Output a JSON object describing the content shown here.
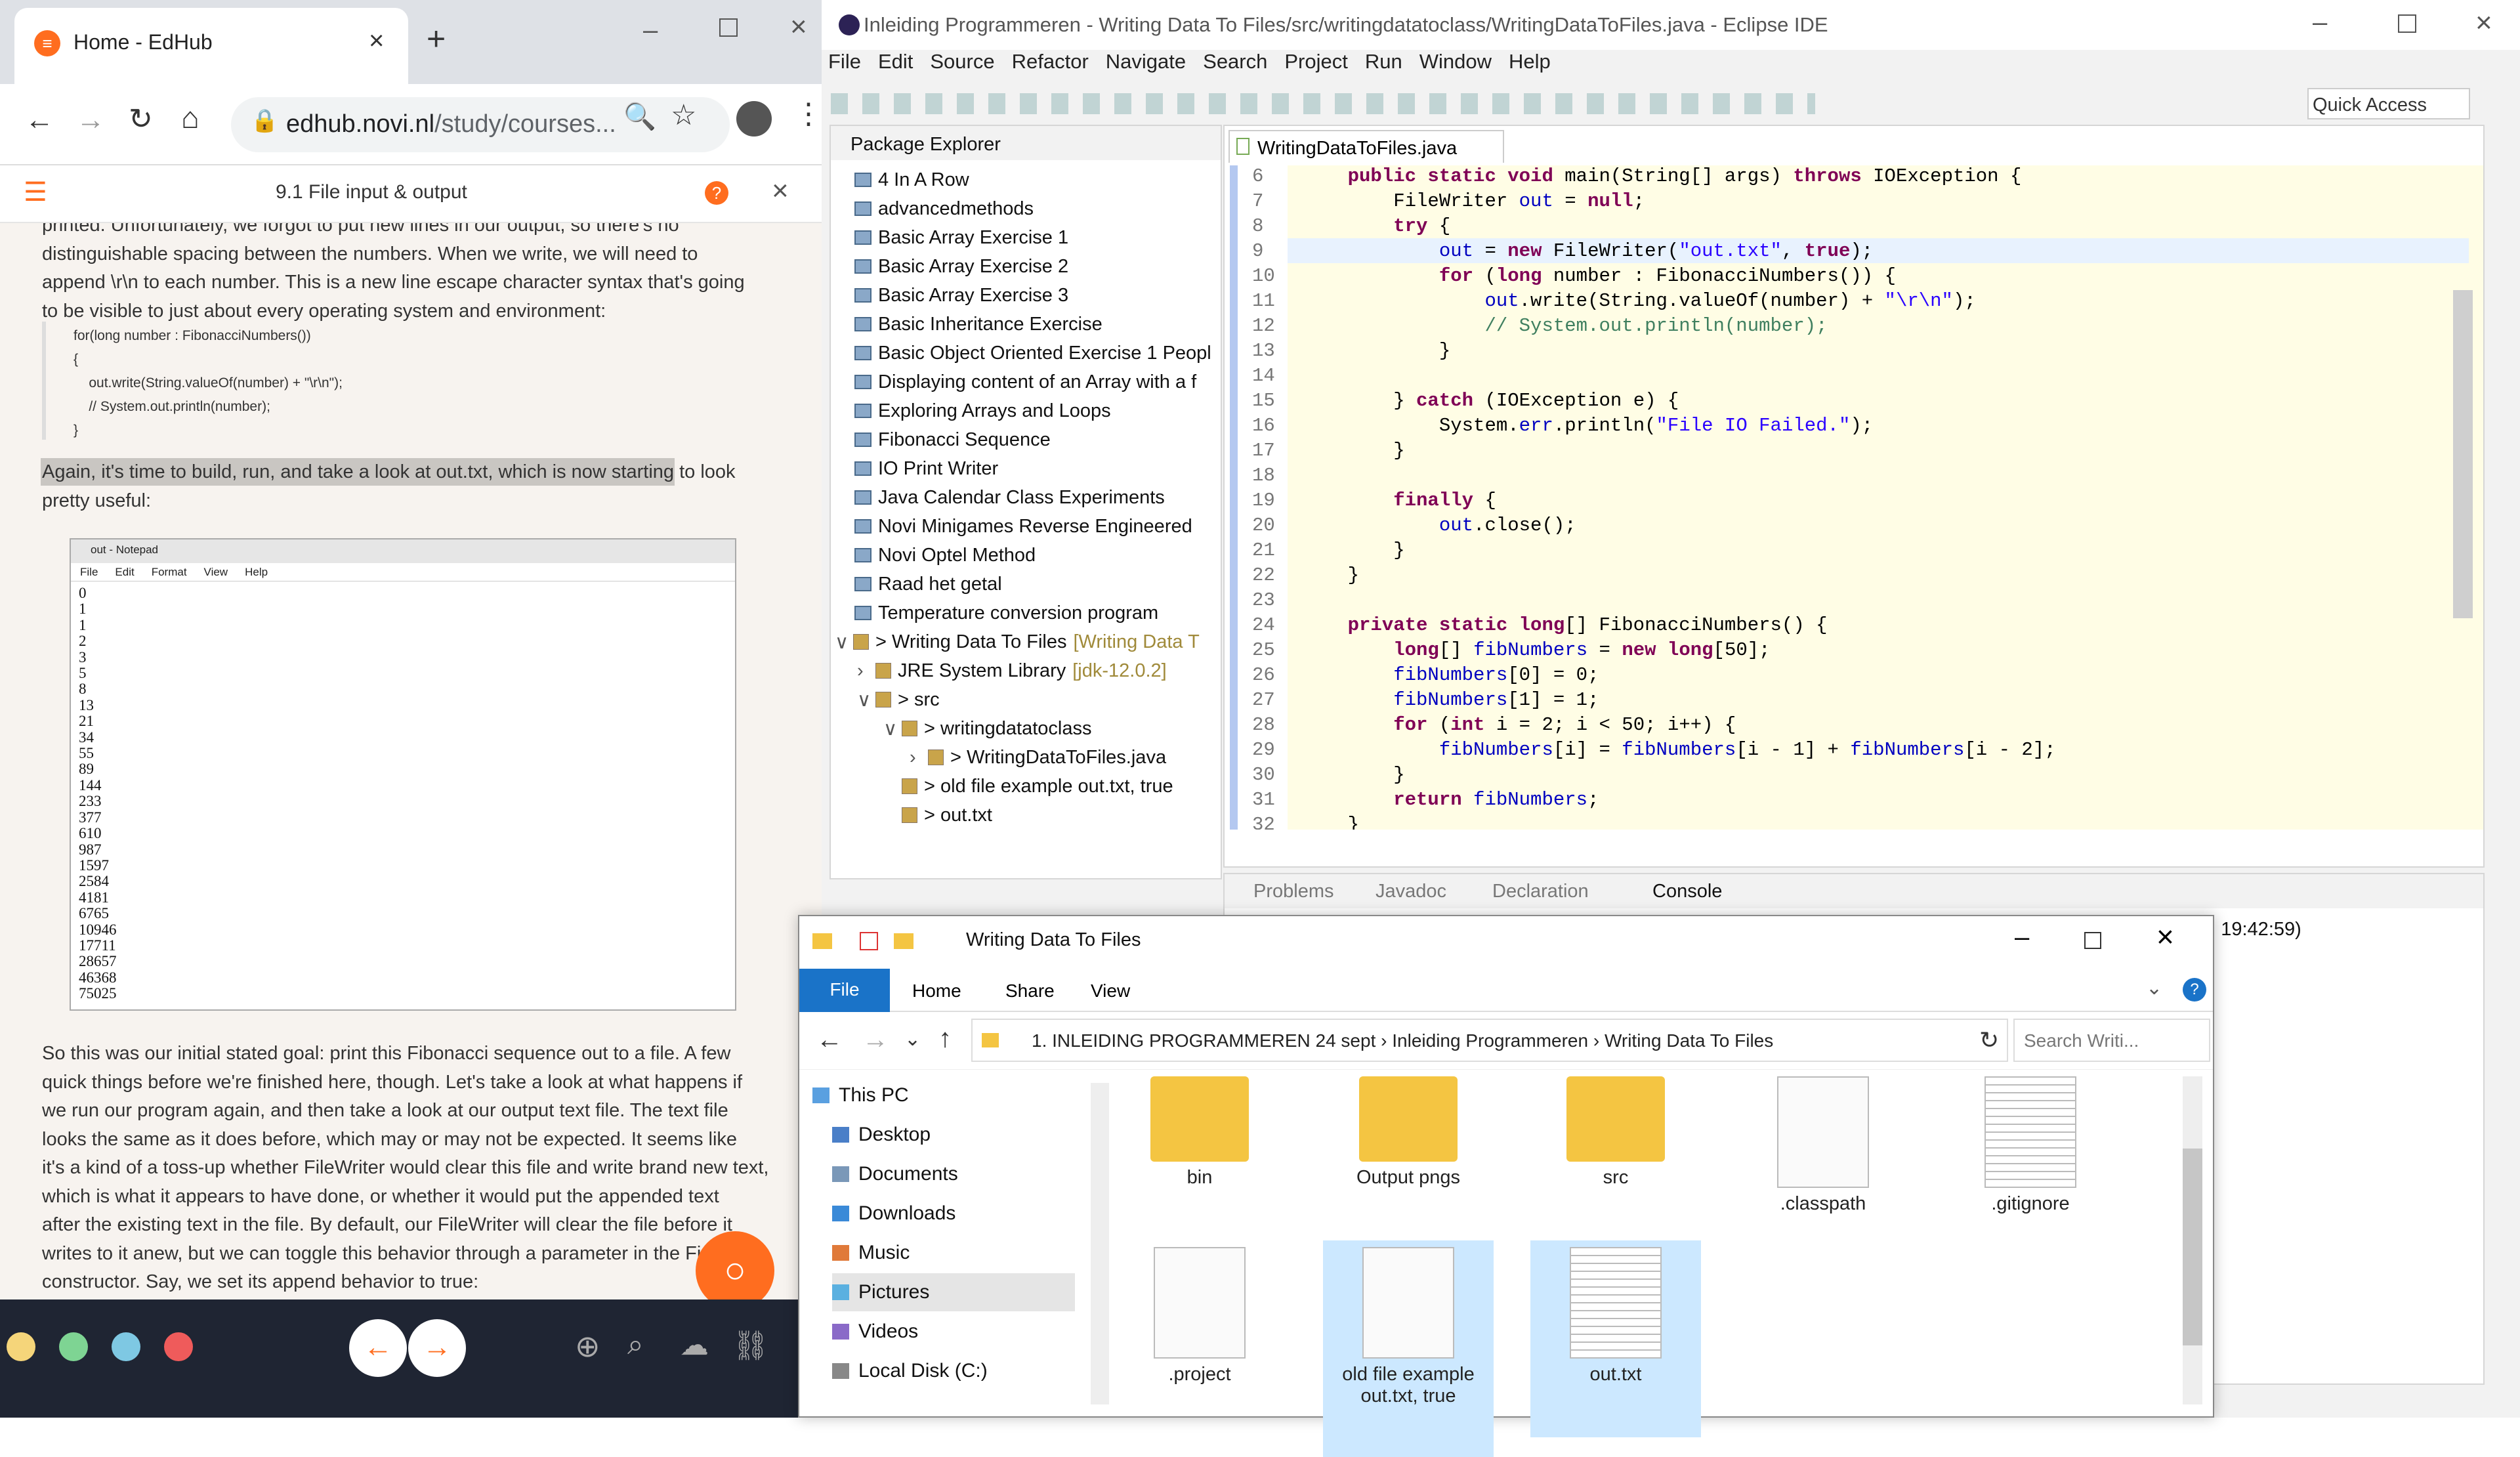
{
  "browser": {
    "tab_title": "Home - EdHub",
    "url_host": "edhub.novi.nl",
    "url_path": "/study/courses...",
    "section_title": "9.1 File input & output",
    "para1_lines": [
      "printed. Unfortunately, we forgot to put new lines in our output, so there's no",
      "distinguishable spacing between the numbers. When we write, we will need to",
      "append \\r\\n to each number. This is a new line escape character syntax that's going",
      "to be visible to just about every operating system and environment:"
    ],
    "code_lines": [
      "for(long number : FibonacciNumbers())",
      "{",
      "    out.write(String.valueOf(number) + \"\\r\\n\");",
      "    // System.out.println(number);",
      "}"
    ],
    "para2_lines": [
      "Again, it's time to build, run, and take a look at out.txt, which is now starting to look",
      "pretty useful:"
    ],
    "notepad": {
      "title": "out - Notepad",
      "menu": [
        "File",
        "Edit",
        "Format",
        "View",
        "Help"
      ],
      "content": "0\n1\n1\n2\n3\n5\n8\n13\n21\n34\n55\n89\n144\n233\n377\n610\n987\n1597\n2584\n4181\n6765\n10946\n17711\n28657\n46368\n75025"
    },
    "para3_lines": [
      "So this was our initial stated goal: print this Fibonacci sequence out to a file. A few",
      "quick things before we're finished here, though. Let's take a look at what happens if",
      "we run our program again, and then take a look at our output text file. The text file",
      "looks the same as it does before, which may or may not be expected. It seems like",
      "it's a kind of a toss-up whether FileWriter would clear this file and write brand new text,",
      "which is what it appears to have done, or whether it would put the appended text",
      "after the existing text in the file. By default, our FileWriter will clear the file before it",
      "writes to it anew, but we can toggle this behavior through a parameter in the Fi",
      "constructor. Say, we set its append behavior to true:"
    ],
    "colors": {
      "accent": "#ff6d1f",
      "dots": [
        "#f5d57a",
        "#7ed493",
        "#7ec8e3",
        "#ef5b5b"
      ]
    }
  },
  "eclipse": {
    "title": "Inleiding Programmeren - Writing Data To Files/src/writingdatatoclass/WritingDataToFiles.java - Eclipse IDE",
    "menu": [
      "File",
      "Edit",
      "Source",
      "Refactor",
      "Navigate",
      "Search",
      "Project",
      "Run",
      "Window",
      "Help"
    ],
    "quick_access": "Quick Access",
    "package_explorer": "Package Explorer",
    "projects": [
      "4 In A Row",
      "advancedmethods",
      "Basic Array Exercise 1",
      "Basic Array Exercise 2",
      "Basic Array Exercise 3",
      "Basic Inheritance Exercise",
      "Basic Object Oriented Exercise 1 Peopl",
      "Displaying content of an Array with a f",
      "Exploring Arrays and Loops",
      "Fibonacci Sequence",
      "IO Print Writer",
      "Java Calendar Class Experiments",
      "Novi Minigames Reverse Engineered",
      "Novi Optel Method",
      "Raad het getal",
      "Temperature conversion program"
    ],
    "open_project": "> Writing Data To Files",
    "open_project_tag": "[Writing Data T",
    "jre": "JRE System Library",
    "jre_tag": "[jdk-12.0.2]",
    "src": "> src",
    "pkg": "> writingdatatoclass",
    "file": "> WritingDataToFiles.java",
    "f1": "> old file example out.txt, true",
    "f2": "> out.txt",
    "editor_tab": "WritingDataToFiles.java",
    "line_numbers": [
      "6",
      "7",
      "8",
      "9",
      "10",
      "11",
      "12",
      "13",
      "14",
      "15",
      "16",
      "17",
      "18",
      "19",
      "20",
      "21",
      "22",
      "23",
      "24",
      "25",
      "26",
      "27",
      "28",
      "29",
      "30",
      "31",
      "32"
    ],
    "views": [
      "Problems",
      "Javadoc",
      "Declaration",
      "Console"
    ],
    "console_text": "9, 19:42:59)"
  },
  "explorer": {
    "title": "Writing Data To Files",
    "ribbon": [
      "File",
      "Home",
      "Share",
      "View"
    ],
    "breadcrumb": [
      "1. INLEIDING PROGRAMMEREN 24 sept",
      "Inleiding Programmeren",
      "Writing Data To Files"
    ],
    "search_placeholder": "Search Writi...",
    "nav": [
      "This PC",
      "Desktop",
      "Documents",
      "Downloads",
      "Music",
      "Pictures",
      "Videos",
      "Local Disk (C:)"
    ],
    "items": [
      "bin",
      "Output pngs",
      "src",
      ".classpath",
      ".gitignore",
      ".project",
      "old file example out.txt, true",
      "out.txt"
    ]
  }
}
